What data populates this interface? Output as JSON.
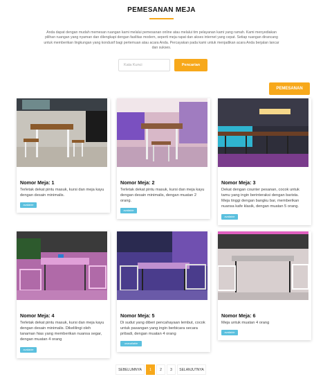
{
  "header": {
    "title": "PEMESANAN MEJA",
    "intro": "Anda dapat dengan mudah memesan ruangan kami melalui pemesanan online atau melalui tim pelayanan kami yang ramah. Kami menyediakan pilihan ruangan yang nyaman dan dilengkapi dengan fasilitas modern, seperti meja rapat dan akses internet yang cepat. Setiap ruangan dirancang untuk memberikan lingkungan yang kondusif bagi pertemuan atau acara Anda. Percayakan pada kami untuk menjadikan acara Anda berjalan lancar dan sukses."
  },
  "search": {
    "placeholder": "Kata Kunci",
    "button_label": "Pencarian"
  },
  "order_button_label": "PEMESANAN",
  "cards": [
    {
      "title": "Nomor Meja: 1",
      "description": "Terletak dekat pintu masuk, kursi dan meja kayu dengan desain minimalis.",
      "status": "available"
    },
    {
      "title": "Nomor Meja: 2",
      "description": "Terletak dekat pintu masuk, kursi dan meja kayu dengan desain minimalis, dengan muatan 2 orang.",
      "status": "available"
    },
    {
      "title": "Nomor Meja: 3",
      "description": "Dekat dengan counter pesanan, cocok untuk tamu yang ingin berinteraksi dengan barista. Meja tinggi dengan bangku bar, memberikan nuansa kafe klasik, dengan muatan 5 orang.",
      "status": "available"
    },
    {
      "title": "Nomor Meja: 4",
      "description": "Terletak dekat pintu masuk, kursi dan meja kayu dengan desain minimalis. Dikelilingi oleh tanaman hias yang memberikan nuansa segar, dengan muatan 4 orang",
      "status": "available"
    },
    {
      "title": "Nomor Meja: 5",
      "description": "Di sudut yang diberi pencahayaan lembut, cocok untuk pasangan yang ingin berbicara secara pribadi, dengan muatan 4 orang",
      "status": "unavailable"
    },
    {
      "title": "Nomor Meja: 6",
      "description": "Meja untuk muatan 4 orang",
      "status": "available"
    }
  ],
  "pagination": {
    "prev_label": "SEBELUMNYA",
    "pages": [
      "1",
      "2",
      "3"
    ],
    "current": "1",
    "next_label": "SELANJUTNYA"
  },
  "colors": {
    "accent": "#f7a81b",
    "badge": "#5bc0de"
  }
}
